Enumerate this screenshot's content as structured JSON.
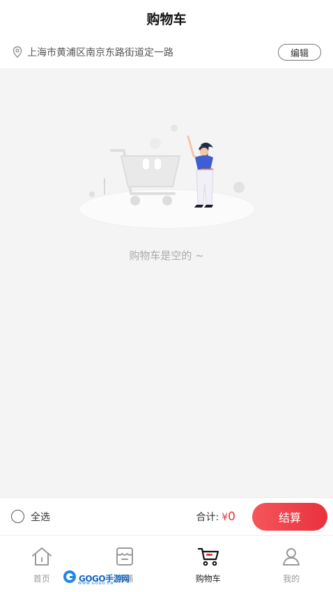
{
  "header": {
    "title": "购物车"
  },
  "address": {
    "text": "上海市黄浦区南京东路街道定一路",
    "edit_label": "编辑"
  },
  "empty_state": {
    "message": "购物车是空的 ~"
  },
  "bottom_bar": {
    "select_all_label": "全选",
    "total_label": "合计:",
    "currency": "¥",
    "total_amount": "0",
    "checkout_label": "结算"
  },
  "tabs": [
    {
      "label": "首页",
      "icon": "home-icon",
      "active": false
    },
    {
      "label": "店铺",
      "icon": "store-icon",
      "active": false
    },
    {
      "label": "购物车",
      "icon": "cart-icon",
      "active": true
    },
    {
      "label": "我的",
      "icon": "profile-icon",
      "active": false
    }
  ],
  "watermark": {
    "text": "GOGO手游网",
    "sub": "WWW.GOGO.CN"
  },
  "colors": {
    "accent": "#e8343c",
    "background": "#f4f4f4"
  }
}
